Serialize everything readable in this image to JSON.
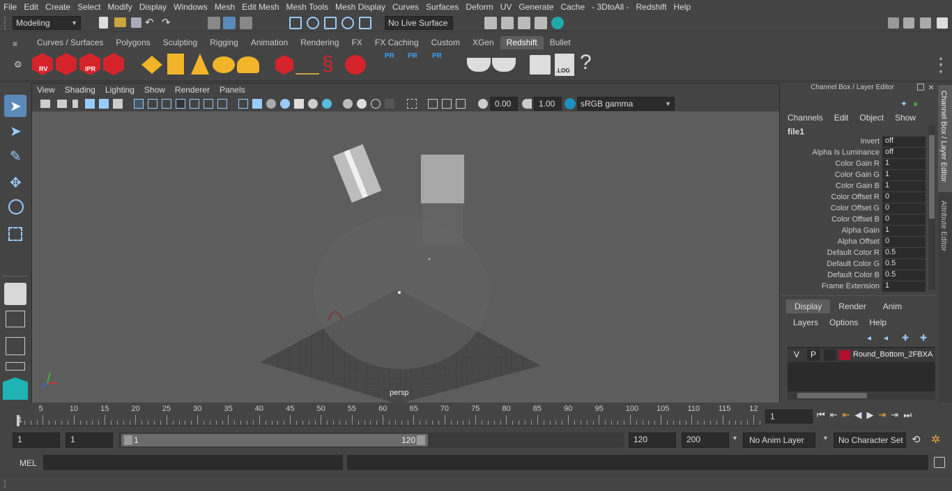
{
  "menubar": [
    "File",
    "Edit",
    "Create",
    "Select",
    "Modify",
    "Display",
    "Windows",
    "Mesh",
    "Edit Mesh",
    "Mesh Tools",
    "Mesh Display",
    "Curves",
    "Surfaces",
    "Deform",
    "UV",
    "Generate",
    "Cache",
    "- 3DtoAll -",
    "Redshift",
    "Help"
  ],
  "status": {
    "workspace": "Modeling",
    "live_surface": "No Live Surface"
  },
  "shelf": {
    "tabs": [
      "Curves / Surfaces",
      "Polygons",
      "Sculpting",
      "Rigging",
      "Animation",
      "Rendering",
      "FX",
      "FX Caching",
      "Custom",
      "XGen",
      "Redshift",
      "Bullet"
    ],
    "active": "Redshift",
    "icon_labels": {
      "rv": "RV",
      "ipr": "IPR",
      "pr": "PR",
      "log": ".LOG",
      "help": "?"
    }
  },
  "viewport": {
    "menus": [
      "View",
      "Shading",
      "Lighting",
      "Show",
      "Renderer",
      "Panels"
    ],
    "exposure": "0.00",
    "gamma": "1.00",
    "colorspace": "sRGB gamma",
    "camera": "persp"
  },
  "channelbox": {
    "title": "Channel Box / Layer Editor",
    "menus": [
      "Channels",
      "Edit",
      "Object",
      "Show"
    ],
    "node": "file1",
    "attrs": [
      [
        "Invert",
        "off"
      ],
      [
        "Alpha Is Luminance",
        "off"
      ],
      [
        "Color Gain R",
        "1"
      ],
      [
        "Color Gain G",
        "1"
      ],
      [
        "Color Gain B",
        "1"
      ],
      [
        "Color Offset R",
        "0"
      ],
      [
        "Color Offset G",
        "0"
      ],
      [
        "Color Offset B",
        "0"
      ],
      [
        "Alpha Gain",
        "1"
      ],
      [
        "Alpha Offset",
        "0"
      ],
      [
        "Default Color R",
        "0.5"
      ],
      [
        "Default Color G",
        "0.5"
      ],
      [
        "Default Color B",
        "0.5"
      ],
      [
        "Frame Extension",
        "1"
      ]
    ]
  },
  "layers": {
    "tabs": [
      "Display",
      "Render",
      "Anim"
    ],
    "active": "Display",
    "menus": [
      "Layers",
      "Options",
      "Help"
    ],
    "row": {
      "v": "V",
      "p": "P",
      "name": "Round_Bottom_2FBXA",
      "color": "#b0102c"
    }
  },
  "sidetabs": [
    "Channel Box / Layer Editor",
    "Attribute Editor"
  ],
  "timeline": {
    "ticks": [
      "1",
      "5",
      "10",
      "15",
      "20",
      "25",
      "30",
      "35",
      "40",
      "45",
      "50",
      "55",
      "60",
      "65",
      "70",
      "75",
      "80",
      "85",
      "90",
      "95",
      "100",
      "105",
      "110",
      "115",
      "12"
    ],
    "current": "1"
  },
  "range": {
    "start": "1",
    "playstart": "1",
    "slider_start": "1",
    "slider_end": "120",
    "end": "120",
    "max": "200",
    "anim_layer": "No Anim Layer",
    "char_set": "No Character Set"
  },
  "cmdline": {
    "label": "MEL"
  }
}
